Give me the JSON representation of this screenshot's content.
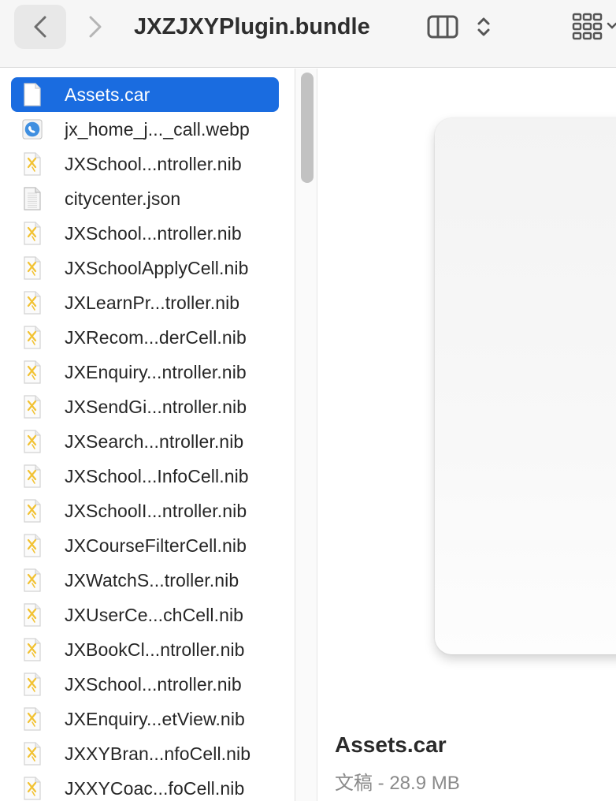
{
  "window": {
    "title": "JXZJXYPlugin.bundle"
  },
  "toolbar": {
    "back_icon": "chevron-left-icon",
    "forward_icon": "chevron-right-icon",
    "view_icon": "column-view-icon",
    "grid_icon": "grid-view-icon"
  },
  "files": [
    {
      "name": "Assets.car",
      "icon": "document-icon",
      "selected": true
    },
    {
      "name": "jx_home_j..._call.webp",
      "icon": "image-file-icon"
    },
    {
      "name": "JXSchool...ntroller.nib",
      "icon": "nib-file-icon"
    },
    {
      "name": "citycenter.json",
      "icon": "text-file-icon"
    },
    {
      "name": "JXSchool...ntroller.nib",
      "icon": "nib-file-icon"
    },
    {
      "name": "JXSchoolApplyCell.nib",
      "icon": "nib-file-icon"
    },
    {
      "name": "JXLearnPr...troller.nib",
      "icon": "nib-file-icon"
    },
    {
      "name": "JXRecom...derCell.nib",
      "icon": "nib-file-icon"
    },
    {
      "name": "JXEnquiry...ntroller.nib",
      "icon": "nib-file-icon"
    },
    {
      "name": "JXSendGi...ntroller.nib",
      "icon": "nib-file-icon"
    },
    {
      "name": "JXSearch...ntroller.nib",
      "icon": "nib-file-icon"
    },
    {
      "name": "JXSchool...InfoCell.nib",
      "icon": "nib-file-icon"
    },
    {
      "name": "JXSchoolI...ntroller.nib",
      "icon": "nib-file-icon"
    },
    {
      "name": "JXCourseFilterCell.nib",
      "icon": "nib-file-icon"
    },
    {
      "name": "JXWatchS...troller.nib",
      "icon": "nib-file-icon"
    },
    {
      "name": "JXUserCe...chCell.nib",
      "icon": "nib-file-icon"
    },
    {
      "name": "JXBookCl...ntroller.nib",
      "icon": "nib-file-icon"
    },
    {
      "name": "JXSchool...ntroller.nib",
      "icon": "nib-file-icon"
    },
    {
      "name": "JXEnquiry...etView.nib",
      "icon": "nib-file-icon"
    },
    {
      "name": "JXXYBran...nfoCell.nib",
      "icon": "nib-file-icon"
    },
    {
      "name": "JXXYCoac...foCell.nib",
      "icon": "nib-file-icon"
    }
  ],
  "preview": {
    "name": "Assets.car",
    "meta": "文稿 - 28.9 MB"
  },
  "colors": {
    "selection": "#1a6ce0",
    "nib_accent": "#f2c233"
  }
}
